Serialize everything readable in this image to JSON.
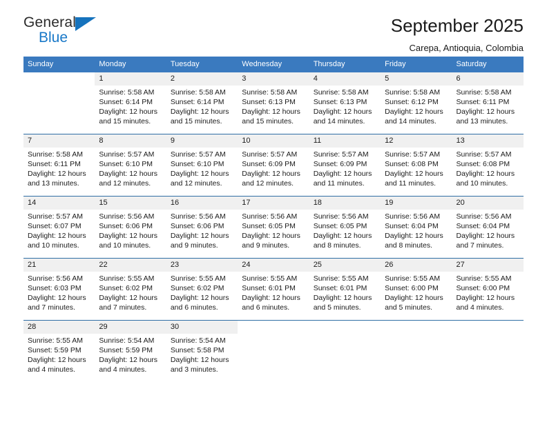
{
  "logo": {
    "word1": "General",
    "word2": "Blue",
    "triangle_color": "#1673bd"
  },
  "header": {
    "title": "September 2025",
    "subtitle": "Carepa, Antioquia, Colombia"
  },
  "theme": {
    "header_blue": "#3a7abf",
    "border_blue": "#2e6da4",
    "daynum_band": "#f0f0f0"
  },
  "weekdays": [
    "Sunday",
    "Monday",
    "Tuesday",
    "Wednesday",
    "Thursday",
    "Friday",
    "Saturday"
  ],
  "weeks": [
    [
      {
        "day": "",
        "sunrise": "",
        "sunset": "",
        "daylight1": "",
        "daylight2": ""
      },
      {
        "day": "1",
        "sunrise": "Sunrise: 5:58 AM",
        "sunset": "Sunset: 6:14 PM",
        "daylight1": "Daylight: 12 hours",
        "daylight2": "and 15 minutes."
      },
      {
        "day": "2",
        "sunrise": "Sunrise: 5:58 AM",
        "sunset": "Sunset: 6:14 PM",
        "daylight1": "Daylight: 12 hours",
        "daylight2": "and 15 minutes."
      },
      {
        "day": "3",
        "sunrise": "Sunrise: 5:58 AM",
        "sunset": "Sunset: 6:13 PM",
        "daylight1": "Daylight: 12 hours",
        "daylight2": "and 15 minutes."
      },
      {
        "day": "4",
        "sunrise": "Sunrise: 5:58 AM",
        "sunset": "Sunset: 6:13 PM",
        "daylight1": "Daylight: 12 hours",
        "daylight2": "and 14 minutes."
      },
      {
        "day": "5",
        "sunrise": "Sunrise: 5:58 AM",
        "sunset": "Sunset: 6:12 PM",
        "daylight1": "Daylight: 12 hours",
        "daylight2": "and 14 minutes."
      },
      {
        "day": "6",
        "sunrise": "Sunrise: 5:58 AM",
        "sunset": "Sunset: 6:11 PM",
        "daylight1": "Daylight: 12 hours",
        "daylight2": "and 13 minutes."
      }
    ],
    [
      {
        "day": "7",
        "sunrise": "Sunrise: 5:58 AM",
        "sunset": "Sunset: 6:11 PM",
        "daylight1": "Daylight: 12 hours",
        "daylight2": "and 13 minutes."
      },
      {
        "day": "8",
        "sunrise": "Sunrise: 5:57 AM",
        "sunset": "Sunset: 6:10 PM",
        "daylight1": "Daylight: 12 hours",
        "daylight2": "and 12 minutes."
      },
      {
        "day": "9",
        "sunrise": "Sunrise: 5:57 AM",
        "sunset": "Sunset: 6:10 PM",
        "daylight1": "Daylight: 12 hours",
        "daylight2": "and 12 minutes."
      },
      {
        "day": "10",
        "sunrise": "Sunrise: 5:57 AM",
        "sunset": "Sunset: 6:09 PM",
        "daylight1": "Daylight: 12 hours",
        "daylight2": "and 12 minutes."
      },
      {
        "day": "11",
        "sunrise": "Sunrise: 5:57 AM",
        "sunset": "Sunset: 6:09 PM",
        "daylight1": "Daylight: 12 hours",
        "daylight2": "and 11 minutes."
      },
      {
        "day": "12",
        "sunrise": "Sunrise: 5:57 AM",
        "sunset": "Sunset: 6:08 PM",
        "daylight1": "Daylight: 12 hours",
        "daylight2": "and 11 minutes."
      },
      {
        "day": "13",
        "sunrise": "Sunrise: 5:57 AM",
        "sunset": "Sunset: 6:08 PM",
        "daylight1": "Daylight: 12 hours",
        "daylight2": "and 10 minutes."
      }
    ],
    [
      {
        "day": "14",
        "sunrise": "Sunrise: 5:57 AM",
        "sunset": "Sunset: 6:07 PM",
        "daylight1": "Daylight: 12 hours",
        "daylight2": "and 10 minutes."
      },
      {
        "day": "15",
        "sunrise": "Sunrise: 5:56 AM",
        "sunset": "Sunset: 6:06 PM",
        "daylight1": "Daylight: 12 hours",
        "daylight2": "and 10 minutes."
      },
      {
        "day": "16",
        "sunrise": "Sunrise: 5:56 AM",
        "sunset": "Sunset: 6:06 PM",
        "daylight1": "Daylight: 12 hours",
        "daylight2": "and 9 minutes."
      },
      {
        "day": "17",
        "sunrise": "Sunrise: 5:56 AM",
        "sunset": "Sunset: 6:05 PM",
        "daylight1": "Daylight: 12 hours",
        "daylight2": "and 9 minutes."
      },
      {
        "day": "18",
        "sunrise": "Sunrise: 5:56 AM",
        "sunset": "Sunset: 6:05 PM",
        "daylight1": "Daylight: 12 hours",
        "daylight2": "and 8 minutes."
      },
      {
        "day": "19",
        "sunrise": "Sunrise: 5:56 AM",
        "sunset": "Sunset: 6:04 PM",
        "daylight1": "Daylight: 12 hours",
        "daylight2": "and 8 minutes."
      },
      {
        "day": "20",
        "sunrise": "Sunrise: 5:56 AM",
        "sunset": "Sunset: 6:04 PM",
        "daylight1": "Daylight: 12 hours",
        "daylight2": "and 7 minutes."
      }
    ],
    [
      {
        "day": "21",
        "sunrise": "Sunrise: 5:56 AM",
        "sunset": "Sunset: 6:03 PM",
        "daylight1": "Daylight: 12 hours",
        "daylight2": "and 7 minutes."
      },
      {
        "day": "22",
        "sunrise": "Sunrise: 5:55 AM",
        "sunset": "Sunset: 6:02 PM",
        "daylight1": "Daylight: 12 hours",
        "daylight2": "and 7 minutes."
      },
      {
        "day": "23",
        "sunrise": "Sunrise: 5:55 AM",
        "sunset": "Sunset: 6:02 PM",
        "daylight1": "Daylight: 12 hours",
        "daylight2": "and 6 minutes."
      },
      {
        "day": "24",
        "sunrise": "Sunrise: 5:55 AM",
        "sunset": "Sunset: 6:01 PM",
        "daylight1": "Daylight: 12 hours",
        "daylight2": "and 6 minutes."
      },
      {
        "day": "25",
        "sunrise": "Sunrise: 5:55 AM",
        "sunset": "Sunset: 6:01 PM",
        "daylight1": "Daylight: 12 hours",
        "daylight2": "and 5 minutes."
      },
      {
        "day": "26",
        "sunrise": "Sunrise: 5:55 AM",
        "sunset": "Sunset: 6:00 PM",
        "daylight1": "Daylight: 12 hours",
        "daylight2": "and 5 minutes."
      },
      {
        "day": "27",
        "sunrise": "Sunrise: 5:55 AM",
        "sunset": "Sunset: 6:00 PM",
        "daylight1": "Daylight: 12 hours",
        "daylight2": "and 4 minutes."
      }
    ],
    [
      {
        "day": "28",
        "sunrise": "Sunrise: 5:55 AM",
        "sunset": "Sunset: 5:59 PM",
        "daylight1": "Daylight: 12 hours",
        "daylight2": "and 4 minutes."
      },
      {
        "day": "29",
        "sunrise": "Sunrise: 5:54 AM",
        "sunset": "Sunset: 5:59 PM",
        "daylight1": "Daylight: 12 hours",
        "daylight2": "and 4 minutes."
      },
      {
        "day": "30",
        "sunrise": "Sunrise: 5:54 AM",
        "sunset": "Sunset: 5:58 PM",
        "daylight1": "Daylight: 12 hours",
        "daylight2": "and 3 minutes."
      },
      {
        "day": "",
        "sunrise": "",
        "sunset": "",
        "daylight1": "",
        "daylight2": ""
      },
      {
        "day": "",
        "sunrise": "",
        "sunset": "",
        "daylight1": "",
        "daylight2": ""
      },
      {
        "day": "",
        "sunrise": "",
        "sunset": "",
        "daylight1": "",
        "daylight2": ""
      },
      {
        "day": "",
        "sunrise": "",
        "sunset": "",
        "daylight1": "",
        "daylight2": ""
      }
    ]
  ]
}
